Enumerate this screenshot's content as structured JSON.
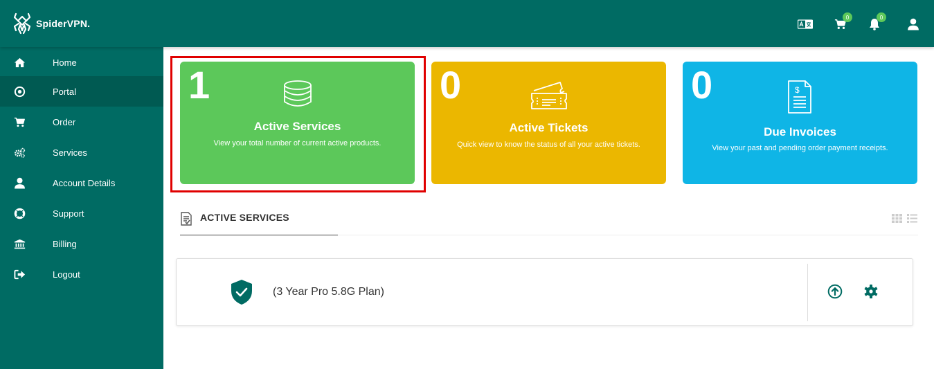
{
  "brand": {
    "name": "SpiderVPN."
  },
  "topbar": {
    "cart_count": "0",
    "notification_count": "0"
  },
  "sidebar": {
    "items": [
      {
        "label": "Home",
        "icon": "home-icon"
      },
      {
        "label": "Portal",
        "icon": "target-icon"
      },
      {
        "label": "Order",
        "icon": "cart-icon"
      },
      {
        "label": "Services",
        "icon": "gears-icon"
      },
      {
        "label": "Account Details",
        "icon": "user-icon"
      },
      {
        "label": "Support",
        "icon": "lifebuoy-icon"
      },
      {
        "label": "Billing",
        "icon": "bank-icon"
      },
      {
        "label": "Logout",
        "icon": "sign-out-icon"
      }
    ],
    "active_index": 1
  },
  "cards": [
    {
      "count": "1",
      "title": "Active Services",
      "subtitle": "View your total number of current active products.",
      "color": "#5cc85a",
      "icon": "database-icon"
    },
    {
      "count": "0",
      "title": "Active Tickets",
      "subtitle": "Quick view to know the  status of all your active tickets.",
      "color": "#ebb700",
      "icon": "ticket-icon"
    },
    {
      "count": "0",
      "title": "Due Invoices",
      "subtitle": "View your past and pending order payment receipts.",
      "color": "#0fb5e6",
      "icon": "invoice-icon"
    }
  ],
  "section": {
    "title": "ACTIVE SERVICES"
  },
  "services": [
    {
      "name": "(3 Year Pro 5.8G Plan)",
      "icon": "shield-check-icon"
    }
  ],
  "colors": {
    "primary": "#006b63",
    "highlight": "#e00000"
  }
}
